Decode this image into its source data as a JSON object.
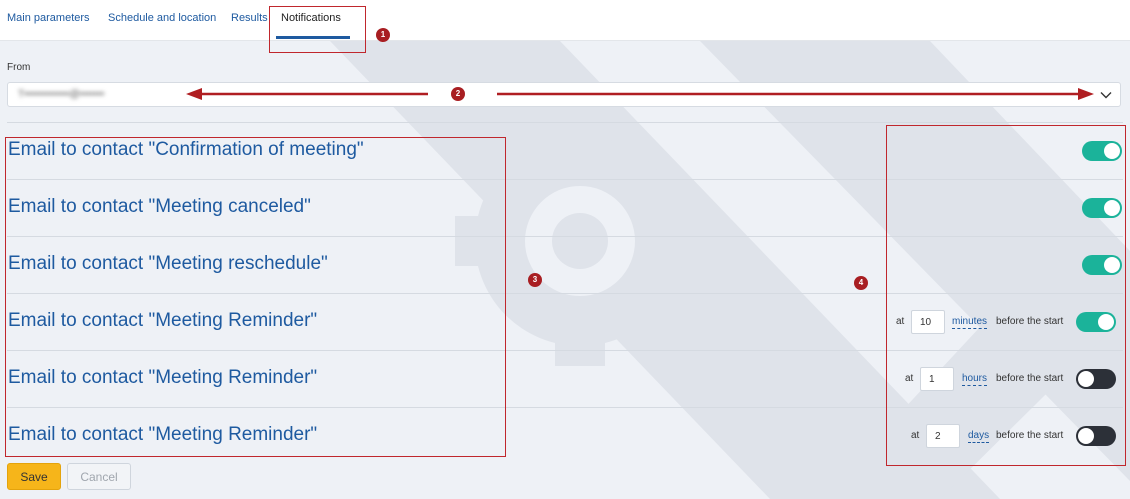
{
  "tabs": [
    {
      "label": "Main parameters"
    },
    {
      "label": "Schedule and location"
    },
    {
      "label": "Results"
    },
    {
      "label": "Notifications",
      "active": true
    }
  ],
  "from": {
    "label": "From",
    "value": "T•••••••••••••@•••••••"
  },
  "notifications": [
    {
      "label": "Email to contact \"Confirmation of meeting\"",
      "enabled": true
    },
    {
      "label": "Email to contact \"Meeting canceled\"",
      "enabled": true
    },
    {
      "label": "Email to contact \"Meeting reschedule\"",
      "enabled": true
    },
    {
      "label": "Email to contact \"Meeting Reminder\"",
      "enabled": true,
      "at": "at",
      "value": "10",
      "unit": "minutes",
      "suffix": "before the start"
    },
    {
      "label": "Email to contact \"Meeting Reminder\"",
      "enabled": false,
      "at": "at",
      "value": "1",
      "unit": "hours",
      "suffix": "before the start"
    },
    {
      "label": "Email to contact \"Meeting Reminder\"",
      "enabled": false,
      "at": "at",
      "value": "2",
      "unit": "days",
      "suffix": "before the start"
    }
  ],
  "markers": [
    "1",
    "2",
    "3",
    "4"
  ],
  "buttons": {
    "save": "Save",
    "cancel": "Cancel"
  },
  "colors": {
    "accent": "#1e5aa0",
    "toggle_on": "#1bb39a",
    "toggle_off": "#2c3038",
    "save": "#f6b51a",
    "annotation": "#c0272d"
  }
}
